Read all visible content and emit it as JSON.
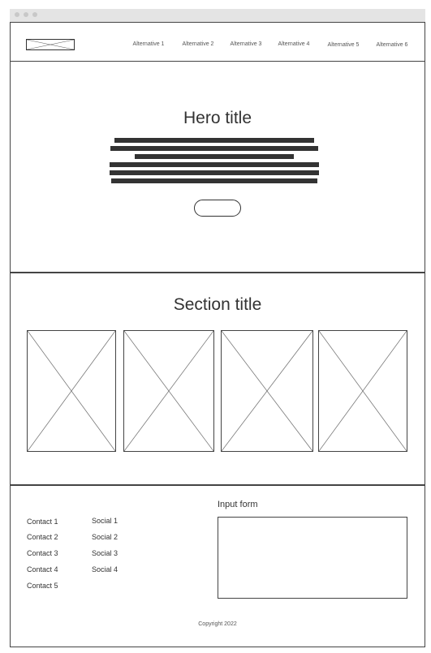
{
  "window": {
    "controls": [
      "close",
      "minimize",
      "maximize"
    ]
  },
  "header": {
    "logo_icon": "image-placeholder-icon",
    "nav": [
      {
        "label": "Alternative 1"
      },
      {
        "label": "Alternative 2"
      },
      {
        "label": "Alternative 3"
      },
      {
        "label": "Alternative 4"
      },
      {
        "label": "Alternative 5"
      },
      {
        "label": "Alternative 6"
      }
    ]
  },
  "hero": {
    "title": "Hero title",
    "text_placeholder_lines": 6
  },
  "section": {
    "title": "Section title",
    "cards": [
      {
        "icon": "image-placeholder-icon"
      },
      {
        "icon": "image-placeholder-icon"
      },
      {
        "icon": "image-placeholder-icon"
      },
      {
        "icon": "image-placeholder-icon"
      }
    ]
  },
  "footer": {
    "contacts": [
      "Contact 1",
      "Contact 2",
      "Contact 3",
      "Contact 4",
      "Contact 5"
    ],
    "socials": [
      "Social 1",
      "Social 2",
      "Social 3",
      "Social 4"
    ],
    "form_label": "Input form",
    "copyright": "Copyright 2022"
  },
  "colors": {
    "outline": "#444444",
    "text": "#333333",
    "titlebar": "#e4e4e4"
  }
}
